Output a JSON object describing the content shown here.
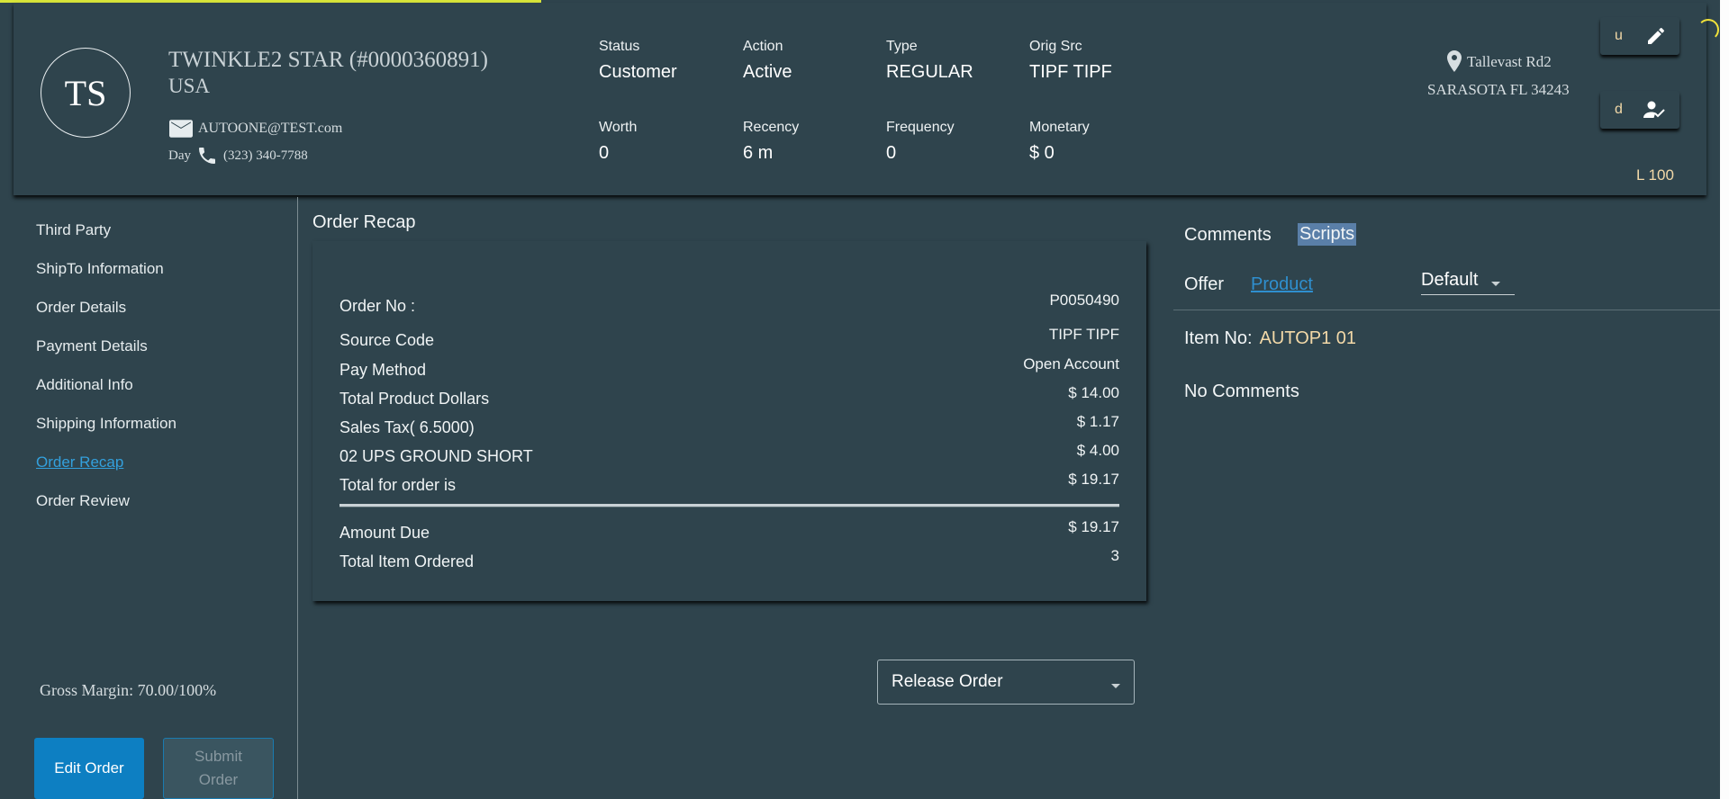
{
  "customer": {
    "initials": "TS",
    "name": "TWINKLE2 STAR (#0000360891)",
    "country": "USA",
    "email": "AUTOONE@TEST.com",
    "phone_label": "Day",
    "phone": "(323) 340-7788"
  },
  "stats": {
    "status": {
      "label": "Status",
      "value": "Customer"
    },
    "action": {
      "label": "Action",
      "value": "Active"
    },
    "type": {
      "label": "Type",
      "value": "REGULAR"
    },
    "orig_src": {
      "label": "Orig Src",
      "value": "TIPF TIPF"
    },
    "worth": {
      "label": "Worth",
      "value": "0"
    },
    "recency": {
      "label": "Recency",
      "value": "6 m"
    },
    "frequency": {
      "label": "Frequency",
      "value": "0"
    },
    "monetary": {
      "label": "Monetary",
      "value": "$ 0"
    }
  },
  "address": {
    "line1": "Tallevast Rd2",
    "line2": "SARASOTA FL 34243"
  },
  "side_buttons": {
    "update_label": "u",
    "detail_label": "d",
    "level": "L 100"
  },
  "nav": {
    "items": [
      "Third Party",
      "ShipTo Information",
      "Order Details",
      "Payment Details",
      "Additional Info",
      "Shipping Information",
      "Order Recap",
      "Order Review"
    ]
  },
  "gross_margin": "Gross Margin: 70.00/100%",
  "buttons": {
    "edit_order": "Edit Order",
    "submit_line1": "Submit",
    "submit_line2": "Order"
  },
  "recap": {
    "title": "Order Recap",
    "rows": [
      {
        "label": "Order No :",
        "value": "P0050490"
      },
      {
        "label": "Source Code",
        "value": "TIPF TIPF"
      },
      {
        "label": "Pay Method",
        "value": "Open Account"
      },
      {
        "label": "Total Product Dollars",
        "value": "$ 14.00"
      },
      {
        "label": "Sales Tax( 6.5000)",
        "value": "$ 1.17"
      },
      {
        "label": "02 UPS GROUND SHORT",
        "value": "$ 4.00"
      },
      {
        "label": "Total for order is",
        "value": "$ 19.17"
      }
    ],
    "amount_due": {
      "label": "Amount Due",
      "value": "$ 19.17"
    },
    "total_items": {
      "label": "Total Item Ordered",
      "value": "3"
    }
  },
  "release_select": {
    "value": "Release Order"
  },
  "right_panel": {
    "tab_comments": "Comments",
    "tab_scripts": "Scripts",
    "tab_offer": "Offer",
    "tab_product": "Product",
    "filter_value": "Default",
    "item_label": "Item No:",
    "item_code": "AUTOP1 01",
    "no_comments": "No Comments"
  },
  "colors": {
    "background": "#2f444d",
    "accent_blue": "#0d7fc2",
    "link_blue": "#33a0dd",
    "highlight_tan": "#f3d9a8",
    "progress_yellow": "#d9e63a"
  }
}
